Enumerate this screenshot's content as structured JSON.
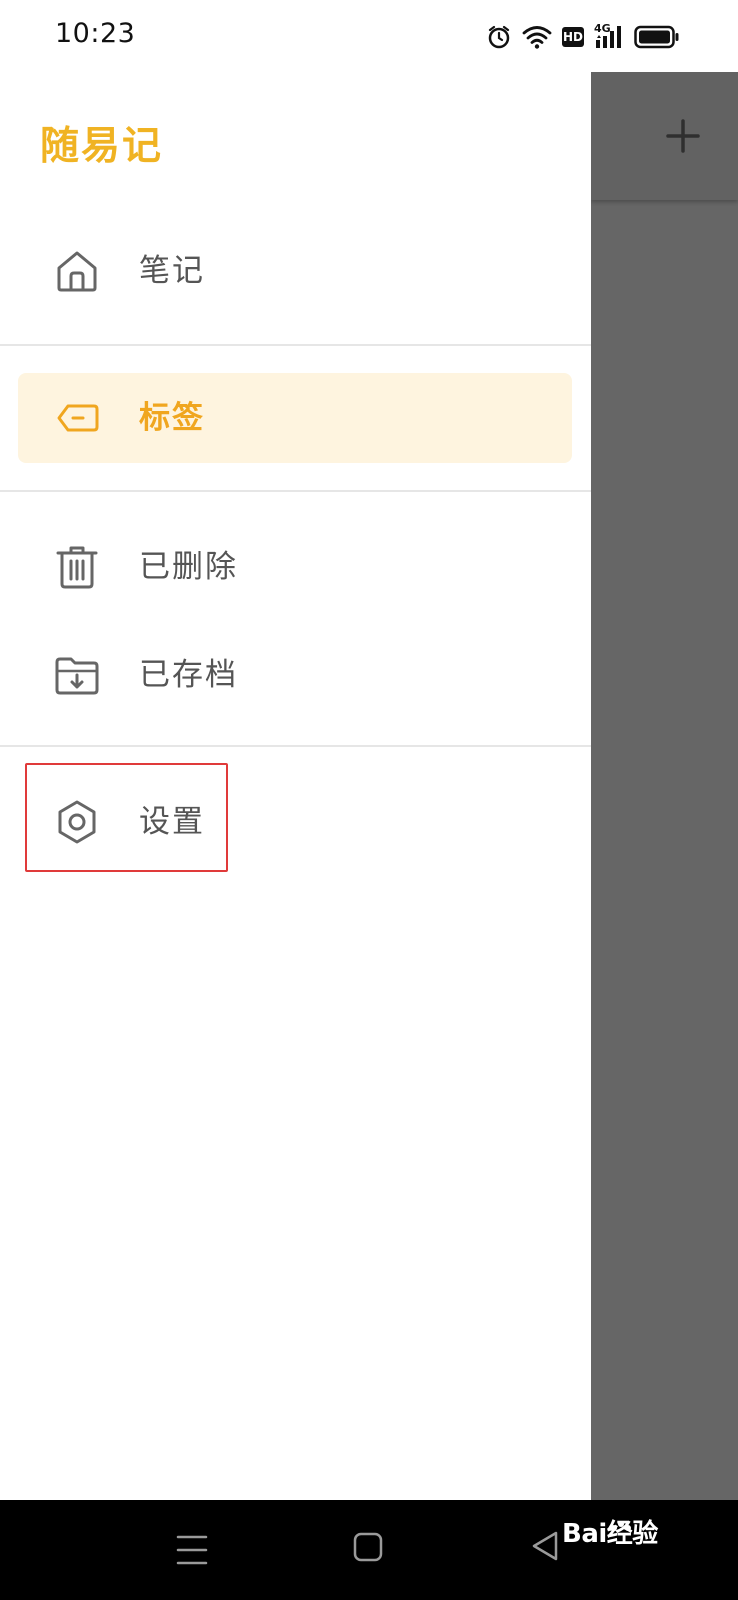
{
  "status_bar": {
    "time": "10:23",
    "icons": [
      "alarm-icon",
      "wifi-icon",
      "hd-icon",
      "4g-signal-icon",
      "battery-icon"
    ],
    "hd_label": "HD",
    "network_label": "4G"
  },
  "drawer": {
    "app_title": "随易记",
    "items": [
      {
        "label": "笔记",
        "icon": "home-icon",
        "active": false
      },
      {
        "label": "标签",
        "icon": "tag-icon",
        "active": true
      },
      {
        "label": "已删除",
        "icon": "trash-icon",
        "active": false
      },
      {
        "label": "已存档",
        "icon": "archive-folder-icon",
        "active": false
      },
      {
        "label": "设置",
        "icon": "gear-icon",
        "active": false
      }
    ]
  },
  "background_toolbar": {
    "add_icon": "plus-icon"
  },
  "navigation_bar": {
    "buttons": [
      "menu-icon",
      "home-square-icon",
      "back-triangle-icon"
    ]
  },
  "watermark": {
    "text": "Bai经验"
  },
  "colors": {
    "accent": "#f0b323",
    "active_background": "#fef4df",
    "scrim": "#666666",
    "highlight_box": "#e03a3a"
  }
}
